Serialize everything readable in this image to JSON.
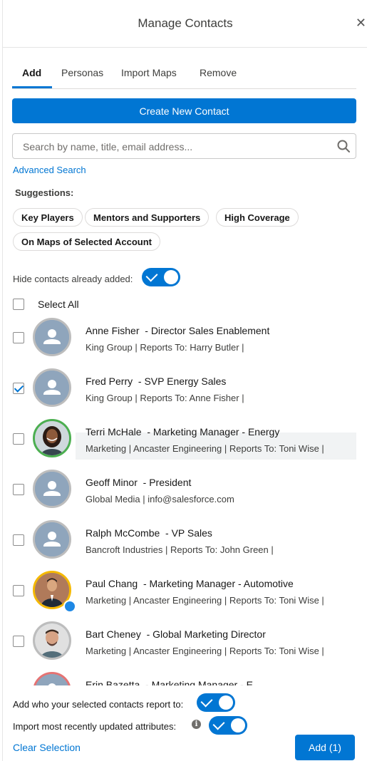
{
  "header": {
    "title": "Manage Contacts",
    "close_glyph": "✕"
  },
  "tabs": [
    {
      "label": "Add",
      "active": true
    },
    {
      "label": "Personas",
      "active": false
    },
    {
      "label": "Import Maps",
      "active": false
    },
    {
      "label": "Remove",
      "active": false
    }
  ],
  "create_button_label": "Create New Contact",
  "search": {
    "placeholder": "Search by name, title, email address...",
    "value": "",
    "icon": "search-icon"
  },
  "advanced_search_label": "Advanced Search",
  "suggestions": {
    "label": "Suggestions:",
    "pills": [
      "Key Players",
      "Mentors and Supporters",
      "High Coverage",
      "On Maps of Selected Account"
    ]
  },
  "hide_added": {
    "label": "Hide contacts already added:",
    "on": true
  },
  "select_all": {
    "label": "Select All",
    "checked": false
  },
  "contacts": [
    {
      "name": "Anne Fisher",
      "title": "- Director Sales Enablement",
      "details": "King Group | Reports To: Harry Butler |",
      "checked": false,
      "avatar": "placeholder",
      "ring": "gray"
    },
    {
      "name": "Fred Perry",
      "title": "- SVP Energy Sales",
      "details": "King Group | Reports To: Anne Fisher |",
      "checked": true,
      "avatar": "placeholder",
      "ring": "gray"
    },
    {
      "name": "Terri McHale",
      "title": "- Marketing Manager - Energy",
      "details": "Marketing | Ancaster Engineering | Reports To: Toni Wise |",
      "checked": false,
      "avatar": "photo-woman",
      "ring": "green",
      "highlighted": true
    },
    {
      "name": "Geoff Minor",
      "title": "- President",
      "details": "Global Media | info@salesforce.com",
      "checked": false,
      "avatar": "placeholder",
      "ring": "gray"
    },
    {
      "name": "Ralph McCombe",
      "title": "- VP Sales",
      "details": "Bancroft Industries | Reports To: John Green |",
      "checked": false,
      "avatar": "placeholder",
      "ring": "gray"
    },
    {
      "name": "Paul Chang",
      "title": "- Marketing Manager - Automotive",
      "details": "Marketing | Ancaster Engineering | Reports To: Toni Wise |",
      "checked": false,
      "avatar": "photo-man-suit",
      "ring": "yellow",
      "badge": true
    },
    {
      "name": "Bart Cheney",
      "title": "- Global Marketing Director",
      "details": "Marketing | Ancaster Engineering | Reports To: Toni Wise |",
      "checked": false,
      "avatar": "photo-man-smile",
      "ring": "gray"
    },
    {
      "name": "Erin Bazetta",
      "title": "- Marketing Manager - E",
      "details": "",
      "checked": false,
      "avatar": "placeholder",
      "ring": "red"
    }
  ],
  "footer": {
    "report_to_label": "Add who your selected contacts report to:",
    "report_to_on": true,
    "import_attr_label": "Import most recently updated attributes:",
    "import_attr_on": true,
    "info_glyph": "i",
    "clear_label": "Clear Selection",
    "add_label": "Add (1)"
  },
  "colors": {
    "brand": "#0176d3",
    "text": "#181818"
  }
}
